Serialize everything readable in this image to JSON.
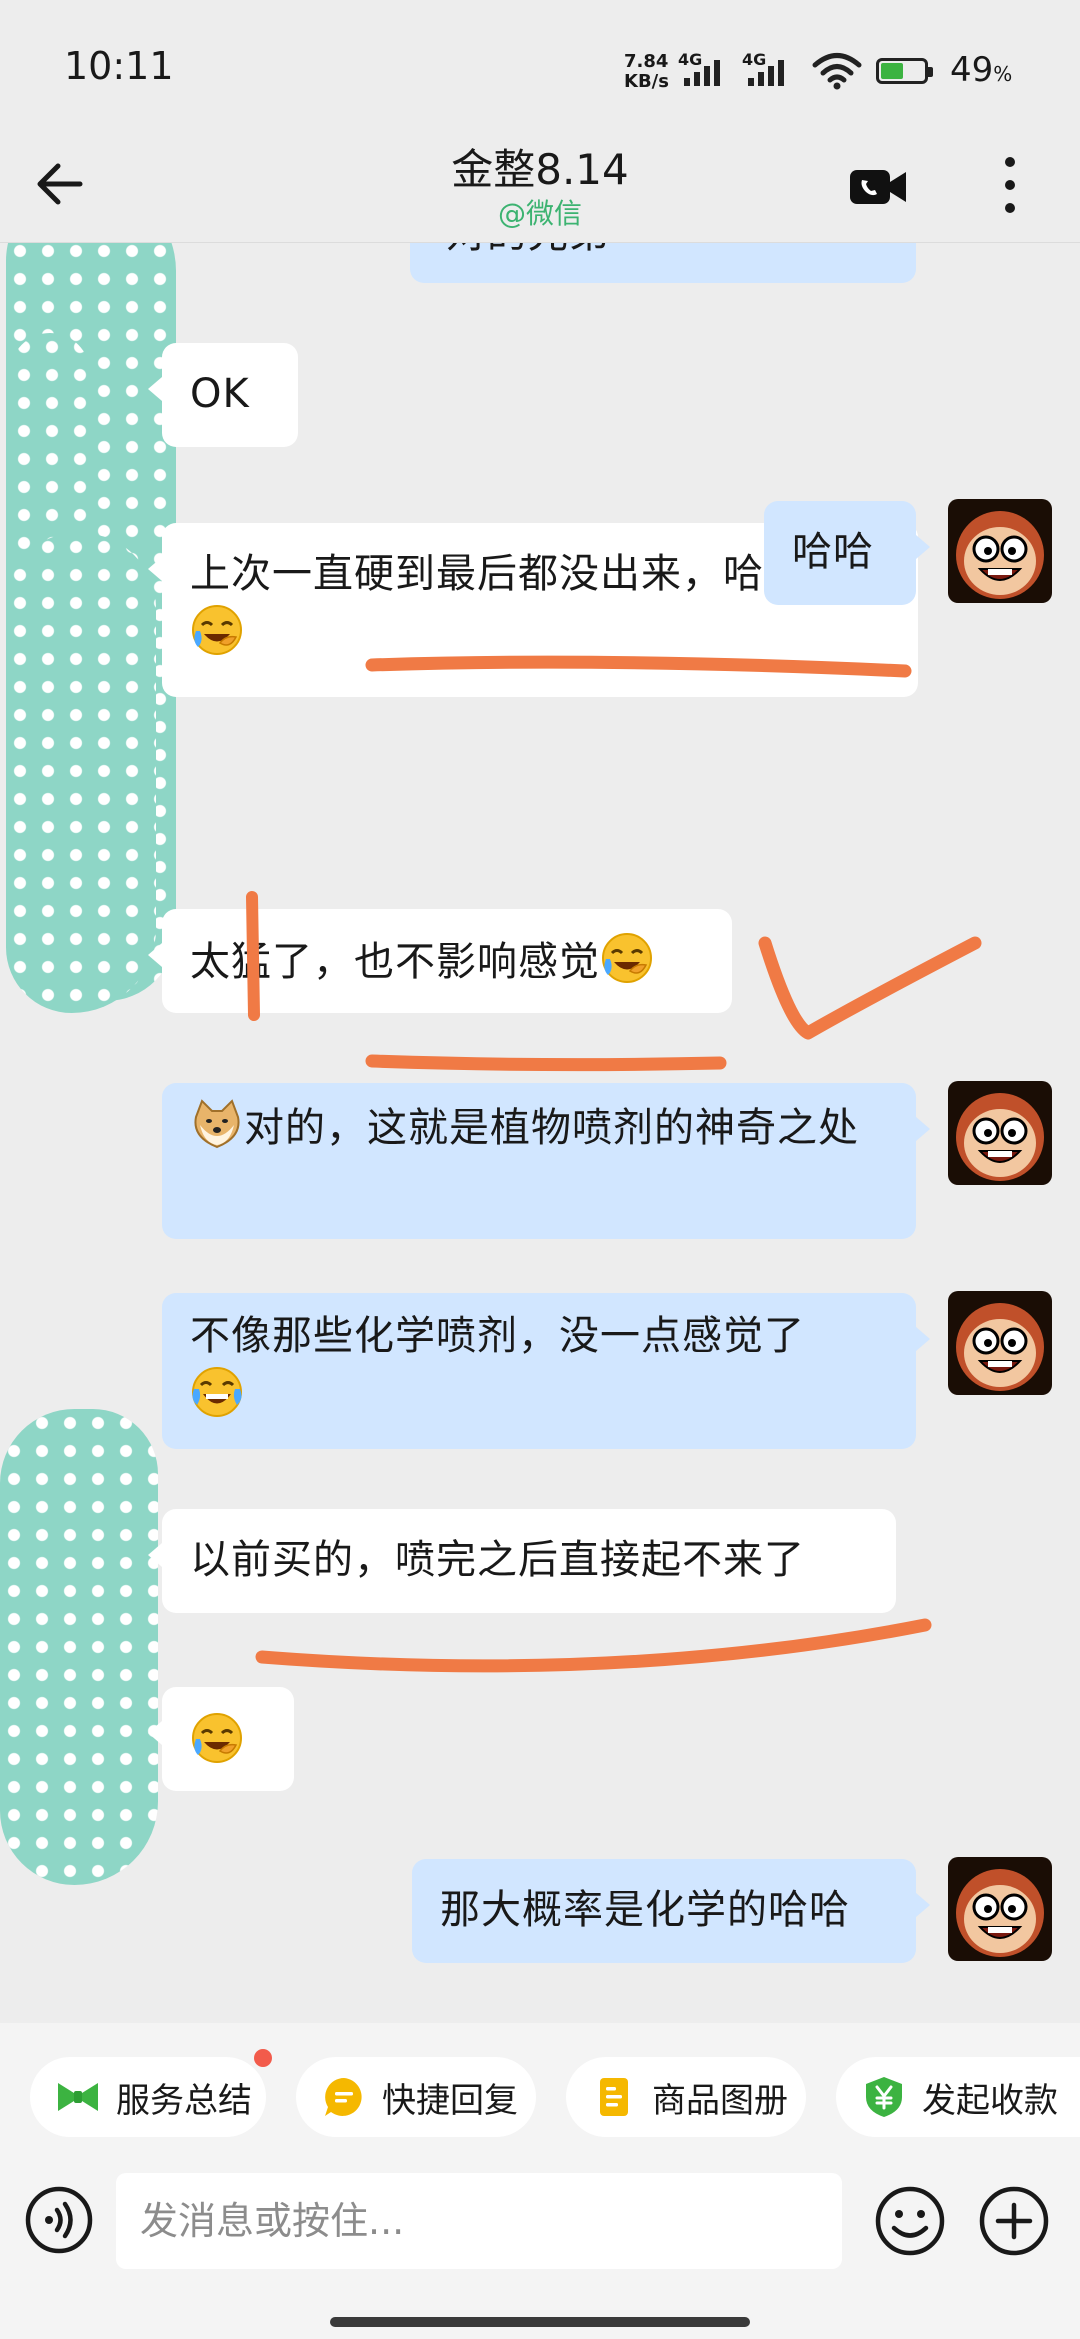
{
  "status_bar": {
    "time": "10:11",
    "net_speed_value": "7.84",
    "net_speed_unit": "KB/s",
    "sim1_label": "4G",
    "sim2_label": "4G",
    "battery_percent": "49",
    "battery_percent_sign": "%"
  },
  "header": {
    "title": "金整8.14",
    "subtitle": "@微信"
  },
  "messages": [
    {
      "side": "out",
      "text": "对的兄弟",
      "partially_visible": true
    },
    {
      "side": "in",
      "text": "OK"
    },
    {
      "side": "in",
      "text": "上次一直硬到最后都没出来，哈哈",
      "emoji": "crying-laughing"
    },
    {
      "side": "out",
      "text": "哈哈"
    },
    {
      "side": "in",
      "text": "太猛了，也不影响感觉",
      "emoji": "crying-laughing"
    },
    {
      "side": "out",
      "lead_emoji": "doge",
      "text": "对的，这就是植物喷剂的神奇之处"
    },
    {
      "side": "out",
      "text": "不像那些化学喷剂，没一点感觉了",
      "emoji": "tears-of-joy"
    },
    {
      "side": "in",
      "text": "以前买的，喷完之后直接起不来了"
    },
    {
      "side": "in",
      "emoji": "crying-laughing"
    },
    {
      "side": "out",
      "text": "那大概率是化学的哈哈"
    }
  ],
  "quick_actions": [
    {
      "label": "服务总结",
      "icon": "bow-tie-icon",
      "color": "#3cb341",
      "has_badge": true
    },
    {
      "label": "快捷回复",
      "icon": "chat-bubble-icon",
      "color": "#f5b800"
    },
    {
      "label": "商品图册",
      "icon": "catalog-icon",
      "color": "#f5b800"
    },
    {
      "label": "发起收款",
      "icon": "yen-shield-icon",
      "color": "#3cb341"
    }
  ],
  "input": {
    "placeholder": "发消息或按住..."
  },
  "colors": {
    "background": "#ededed",
    "incoming_bubble": "#ffffff",
    "outgoing_bubble": "#d1e6ff",
    "annotation_stroke": "#f07a45",
    "redaction_blob": "#8ed6c6",
    "subtitle_green": "#3cb371"
  }
}
